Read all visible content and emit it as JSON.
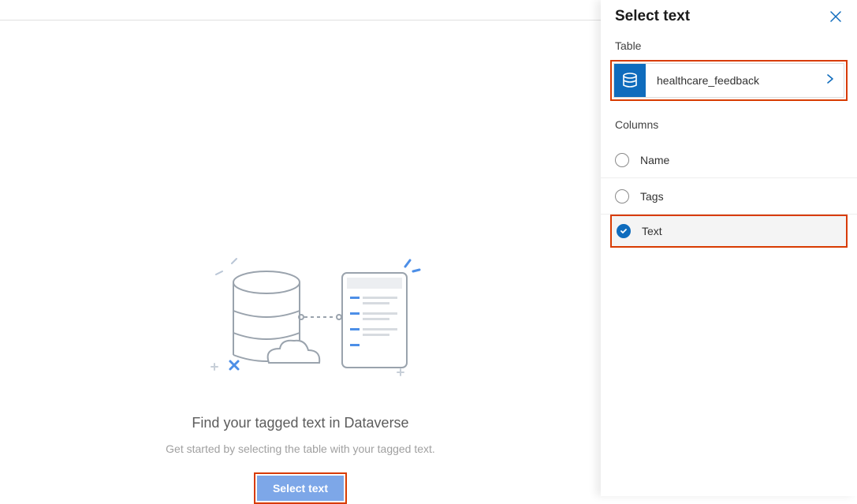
{
  "main": {
    "heading": "Find your tagged text in Dataverse",
    "subtext": "Get started by selecting the table with your tagged text.",
    "button_label": "Select text"
  },
  "panel": {
    "title": "Select text",
    "table_section_label": "Table",
    "table_name": "healthcare_feedback",
    "columns_section_label": "Columns",
    "columns": [
      {
        "label": "Name",
        "selected": false
      },
      {
        "label": "Tags",
        "selected": false
      },
      {
        "label": "Text",
        "selected": true
      }
    ]
  },
  "colors": {
    "accent": "#0f6cbd",
    "highlight_border": "#d83b01"
  }
}
